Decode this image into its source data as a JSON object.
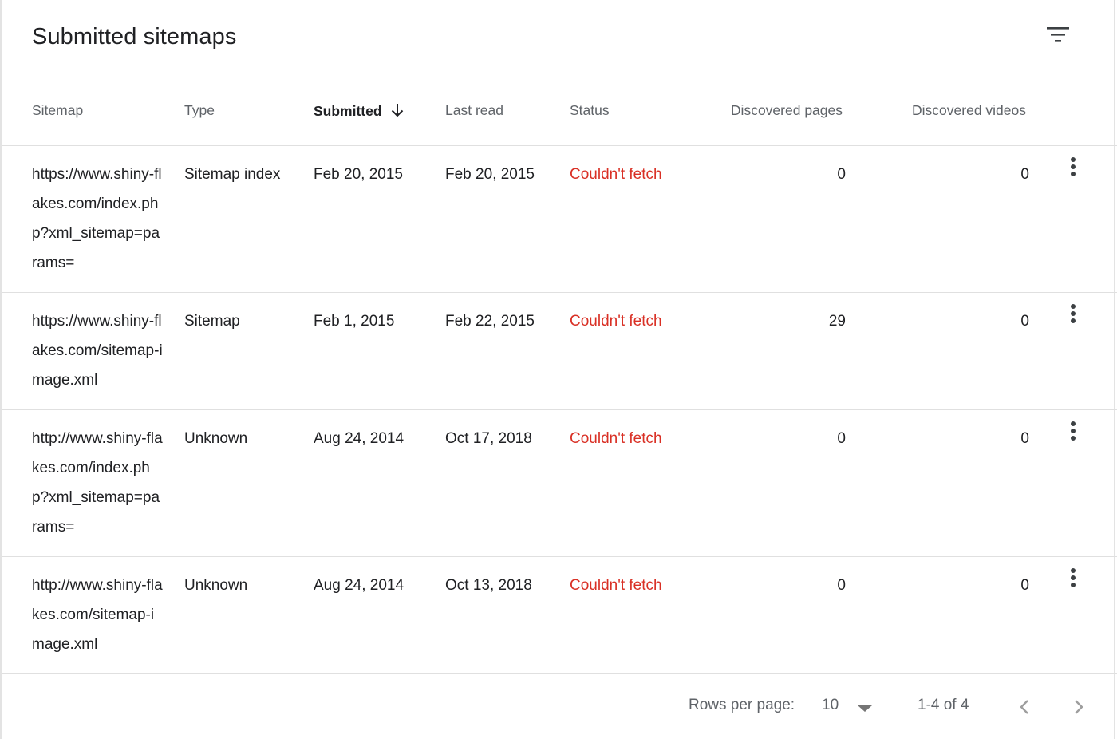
{
  "title": "Submitted sitemaps",
  "icons": {
    "filter": "filter-icon",
    "sort": "arrow-down-icon",
    "more": "more-vert-icon",
    "dropdown": "caret-down-icon",
    "prev": "chevron-left-icon",
    "next": "chevron-right-icon"
  },
  "colors": {
    "error": "#d93025",
    "header_text": "#5f6368",
    "body_text": "#202124",
    "divider": "#e0e0e0"
  },
  "columns": {
    "sitemap": "Sitemap",
    "type": "Type",
    "submitted": "Submitted",
    "last_read": "Last read",
    "status": "Status",
    "discovered_pages": "Discovered pages",
    "discovered_videos": "Discovered videos"
  },
  "rows": [
    {
      "sitemap": "https://www.shiny-flakes.com/index.php?xml_sitemap=params=",
      "type": "Sitemap index",
      "submitted": "Feb 20, 2015",
      "last_read": "Feb 20, 2015",
      "status": "Couldn't fetch",
      "discovered_pages": "0",
      "discovered_videos": "0"
    },
    {
      "sitemap": "https://www.shiny-flakes.com/sitemap-image.xml",
      "type": "Sitemap",
      "submitted": "Feb 1, 2015",
      "last_read": "Feb 22, 2015",
      "status": "Couldn't fetch",
      "discovered_pages": "29",
      "discovered_videos": "0"
    },
    {
      "sitemap": "http://www.shiny-flakes.com/index.php?xml_sitemap=params=",
      "type": "Unknown",
      "submitted": "Aug 24, 2014",
      "last_read": "Oct 17, 2018",
      "status": "Couldn't fetch",
      "discovered_pages": "0",
      "discovered_videos": "0"
    },
    {
      "sitemap": "http://www.shiny-flakes.com/sitemap-image.xml",
      "type": "Unknown",
      "submitted": "Aug 24, 2014",
      "last_read": "Oct 13, 2018",
      "status": "Couldn't fetch",
      "discovered_pages": "0",
      "discovered_videos": "0"
    }
  ],
  "footer": {
    "rows_per_page_label": "Rows per page:",
    "rows_per_page_value": "10",
    "range_label": "1-4 of 4"
  }
}
